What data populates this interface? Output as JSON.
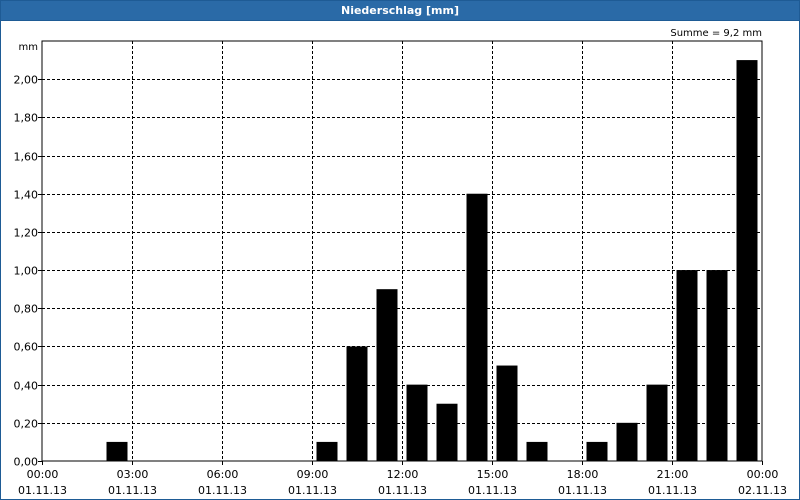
{
  "window": {
    "title": "Niederschlag [mm]"
  },
  "chart_data": {
    "type": "bar",
    "title": "Niederschlag [mm]",
    "ylabel": "mm",
    "annotation": "Summe = 9,2 mm",
    "ylim": [
      0,
      2.2
    ],
    "yticks": [
      "0,00",
      "0,20",
      "0,40",
      "0,60",
      "0,80",
      "1,00",
      "1,20",
      "1,40",
      "1,60",
      "1,80",
      "2,00"
    ],
    "xticks": [
      {
        "time": "00:00",
        "date": "01.11.13"
      },
      {
        "time": "03:00",
        "date": "01.11.13"
      },
      {
        "time": "06:00",
        "date": "01.11.13"
      },
      {
        "time": "09:00",
        "date": "01.11.13"
      },
      {
        "time": "12:00",
        "date": "01.11.13"
      },
      {
        "time": "15:00",
        "date": "01.11.13"
      },
      {
        "time": "18:00",
        "date": "01.11.13"
      },
      {
        "time": "21:00",
        "date": "01.11.13"
      },
      {
        "time": "00:00",
        "date": "02.11.13"
      }
    ],
    "x": [
      "01:00",
      "02:00",
      "03:00",
      "04:00",
      "05:00",
      "06:00",
      "07:00",
      "08:00",
      "09:00",
      "10:00",
      "11:00",
      "12:00",
      "13:00",
      "14:00",
      "15:00",
      "16:00",
      "17:00",
      "18:00",
      "19:00",
      "20:00",
      "21:00",
      "22:00",
      "23:00",
      "00:00"
    ],
    "values": [
      0,
      0,
      0.1,
      0,
      0,
      0,
      0,
      0,
      0,
      0.1,
      0.6,
      0.9,
      0.4,
      0.3,
      1.4,
      0.5,
      0.1,
      0,
      0.1,
      0.2,
      0.4,
      1.0,
      1.0,
      2.1
    ],
    "grid": true,
    "bar_color": "#000000"
  }
}
